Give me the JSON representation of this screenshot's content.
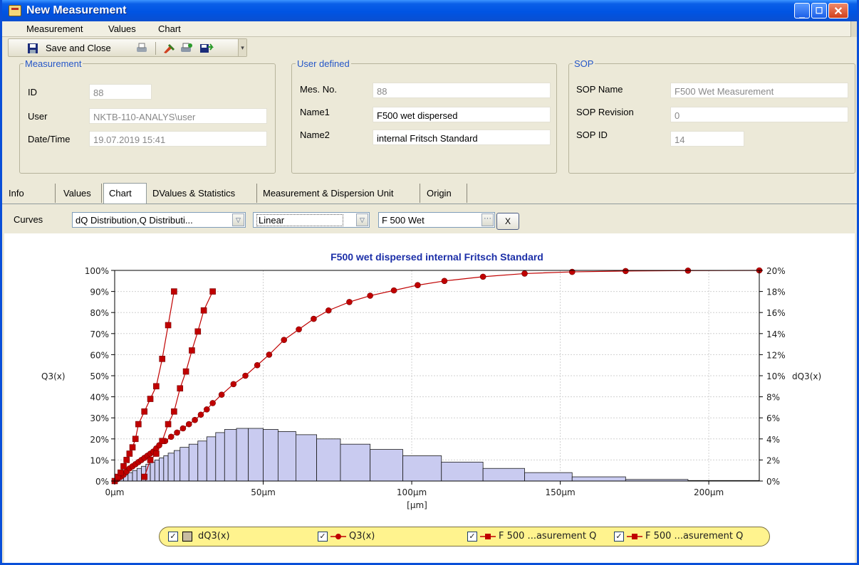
{
  "window": {
    "title": "New Measurement"
  },
  "menu": [
    "Measurement",
    "Values",
    "Chart"
  ],
  "toolbar": {
    "save_label": "Save and Close"
  },
  "measurement": {
    "legend": "Measurement",
    "id_label": "ID",
    "id_value": "88",
    "user_label": "User",
    "user_value": "NKTB-110-ANALYS\\user",
    "datetime_label": "Date/Time",
    "datetime_value": "19.07.2019 15:41"
  },
  "user_defined": {
    "legend": "User defined",
    "mesno_label": "Mes. No.",
    "mesno_value": "88",
    "name1_label": "Name1",
    "name1_value": "F500 wet dispersed",
    "name2_label": "Name2",
    "name2_value": "internal Fritsch Standard"
  },
  "sop": {
    "legend": "SOP",
    "name_label": "SOP Name",
    "name_value": "F500 Wet Measurement",
    "revision_label": "SOP Revision",
    "revision_value": "0",
    "id_label": "SOP ID",
    "id_value": "14"
  },
  "tabs": [
    "Info",
    "Values",
    "Chart",
    "DValues & Statistics",
    "Measurement & Dispersion Unit",
    "Origin"
  ],
  "active_tab": "Chart",
  "curves": {
    "label": "Curves",
    "curves_value": "dQ Distribution,Q Distributi...",
    "scale_value": "Linear",
    "sop_value": "F 500 Wet",
    "x_button": "X"
  },
  "legend_items": [
    "dQ3(x)",
    "Q3(x)",
    "F 500 ...asurement Q",
    "F 500 ...asurement Q"
  ],
  "chart_data": {
    "type": "line",
    "title": "F500 wet dispersed internal Fritsch Standard",
    "xlabel": "[µm]",
    "ylabel_left": "Q3(x)",
    "ylabel_right": "dQ3(x)",
    "xlim": [
      0,
      217
    ],
    "ylim_left": [
      0,
      100
    ],
    "ylim_right": [
      0,
      20
    ],
    "x_ticks": [
      "0µm",
      "50µm",
      "100µm",
      "150µm",
      "200µm"
    ],
    "y_ticks_left": [
      "0%",
      "10%",
      "20%",
      "30%",
      "40%",
      "50%",
      "60%",
      "70%",
      "80%",
      "90%",
      "100%"
    ],
    "y_ticks_right": [
      "0%",
      "2%",
      "4%",
      "6%",
      "8%",
      "10%",
      "12%",
      "14%",
      "16%",
      "18%",
      "20%"
    ],
    "grid": true,
    "colors": {
      "bars": "#c9cbf0",
      "bar_edge": "#1a1a1a",
      "curves": "#c00000",
      "title": "#1c2fa8"
    },
    "histogram": {
      "name": "dQ3(x)",
      "bins": [
        [
          0,
          1.5,
          0.3
        ],
        [
          1.5,
          3,
          0.5
        ],
        [
          3,
          4.5,
          0.6
        ],
        [
          4.5,
          6,
          0.8
        ],
        [
          6,
          7.5,
          1
        ],
        [
          7.5,
          9,
          1.2
        ],
        [
          9,
          10.5,
          1.4
        ],
        [
          10.5,
          12,
          1.6
        ],
        [
          12,
          13.5,
          1.8
        ],
        [
          13.5,
          15,
          2
        ],
        [
          15,
          16.5,
          2.2
        ],
        [
          16.5,
          18,
          2.4
        ],
        [
          18,
          20,
          2.65
        ],
        [
          20,
          22,
          2.9
        ],
        [
          22,
          25,
          3.2
        ],
        [
          25,
          28,
          3.5
        ],
        [
          28,
          31,
          3.8
        ],
        [
          31,
          34,
          4.2
        ],
        [
          34,
          37,
          4.6
        ],
        [
          37,
          41,
          4.9
        ],
        [
          41,
          45,
          5
        ],
        [
          45,
          50,
          5
        ],
        [
          50,
          55,
          4.9
        ],
        [
          55,
          61,
          4.7
        ],
        [
          61,
          68,
          4.4
        ],
        [
          68,
          76,
          4
        ],
        [
          76,
          86,
          3.5
        ],
        [
          86,
          97,
          3
        ],
        [
          97,
          110,
          2.4
        ],
        [
          110,
          124,
          1.8
        ],
        [
          124,
          138,
          1.2
        ],
        [
          138,
          154,
          0.8
        ],
        [
          154,
          172,
          0.4
        ],
        [
          172,
          193,
          0.15
        ],
        [
          193,
          217,
          0.05
        ]
      ]
    },
    "series": [
      {
        "name": "Q3(x)",
        "marker": "circle",
        "x": [
          0,
          1,
          2,
          3,
          4,
          5,
          6,
          7,
          8,
          9,
          10,
          11,
          12,
          13,
          14,
          15,
          17,
          19,
          21,
          23,
          25,
          27,
          29,
          31,
          33,
          36,
          40,
          44,
          48,
          52,
          57,
          62,
          67,
          72,
          79,
          86,
          94,
          102,
          111,
          124,
          138,
          154,
          172,
          193,
          217
        ],
        "y": [
          0,
          1,
          2,
          3,
          4.5,
          6,
          7,
          8,
          9,
          10,
          11,
          12,
          13,
          14,
          15.5,
          17,
          19,
          21,
          23,
          25,
          27,
          29,
          31.5,
          34,
          37,
          41,
          46,
          50,
          55,
          60,
          67,
          72,
          77,
          81,
          85,
          88,
          90.5,
          93,
          95,
          97,
          98.5,
          99.3,
          99.7,
          99.9,
          100
        ]
      },
      {
        "name": "F 500 ...asurement Q",
        "marker": "square",
        "x": [
          0,
          1,
          2,
          3,
          4,
          5,
          6,
          7,
          8,
          10,
          12,
          14,
          16,
          18,
          20
        ],
        "y": [
          0,
          2,
          4,
          7,
          10,
          13,
          16,
          20,
          27,
          33,
          39,
          45,
          58,
          74,
          90
        ]
      },
      {
        "name": "F 500 ...asurement Q",
        "marker": "square",
        "x": [
          10,
          12,
          14,
          16,
          18,
          20,
          22,
          24,
          26,
          28,
          30,
          33
        ],
        "y": [
          2,
          10,
          13,
          19,
          27,
          33,
          44,
          52,
          62,
          71,
          81,
          90
        ]
      }
    ]
  }
}
